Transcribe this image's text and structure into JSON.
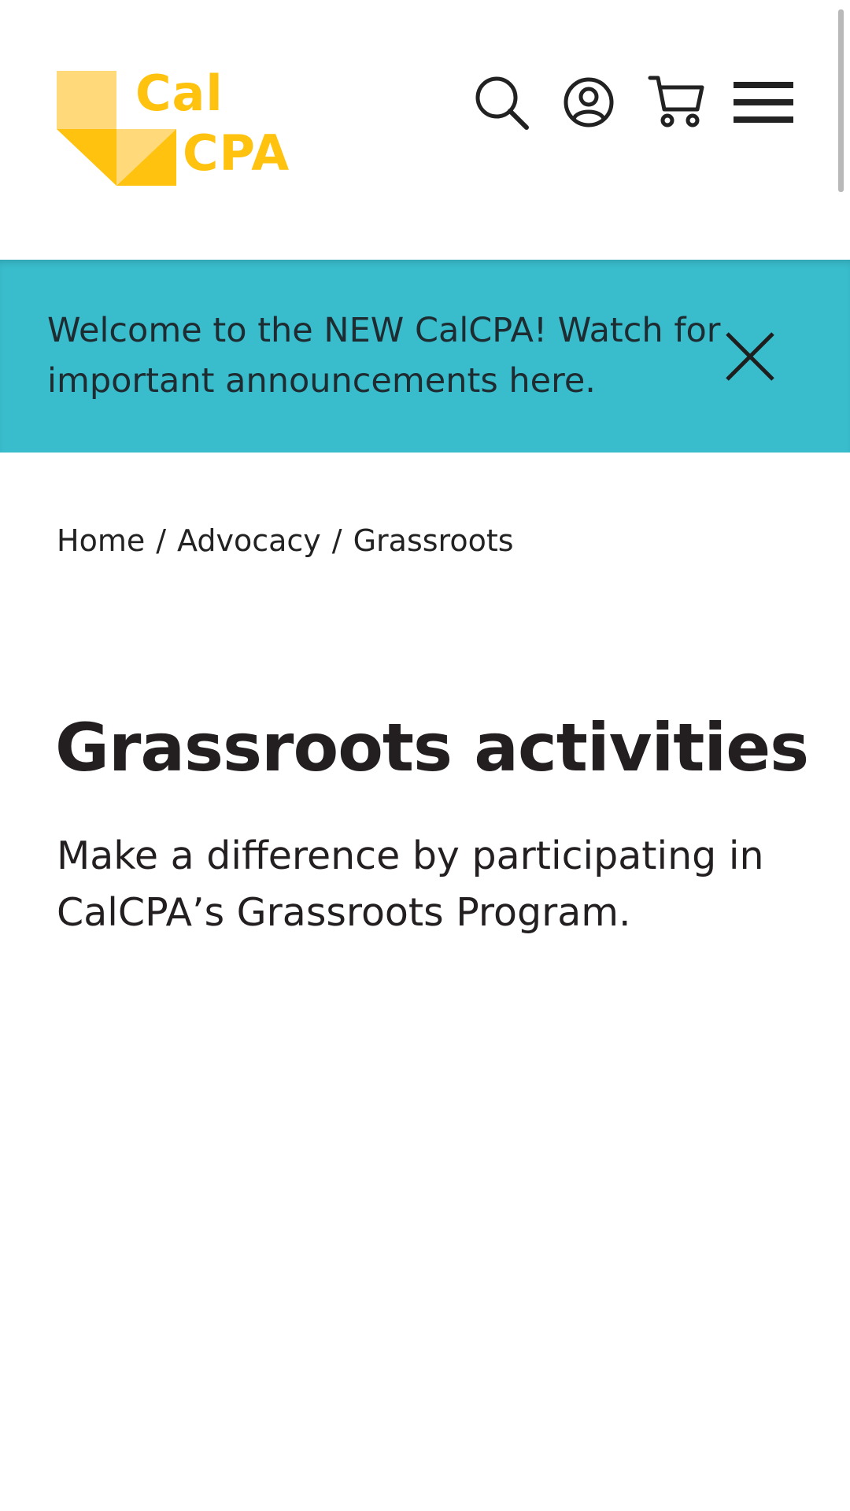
{
  "header": {
    "logo": {
      "line1": "Cal",
      "line2": "CPA",
      "colors": {
        "primary": "#FFC20E",
        "light": "#FFD97A"
      }
    },
    "icons": [
      {
        "name": "search-icon"
      },
      {
        "name": "account-icon"
      },
      {
        "name": "cart-icon"
      },
      {
        "name": "menu-icon"
      }
    ]
  },
  "announcement": {
    "text": "Welcome to the NEW CalCPA! Watch for important announcements here.",
    "background": "#39BCCC",
    "close_icon": "close-icon"
  },
  "breadcrumb": {
    "items": [
      "Home",
      "Advocacy",
      "Grassroots"
    ],
    "separator": "/"
  },
  "main": {
    "title": "Grassroots activities",
    "intro": "Make a difference by participating in CalCPA’s Grassroots Program."
  }
}
